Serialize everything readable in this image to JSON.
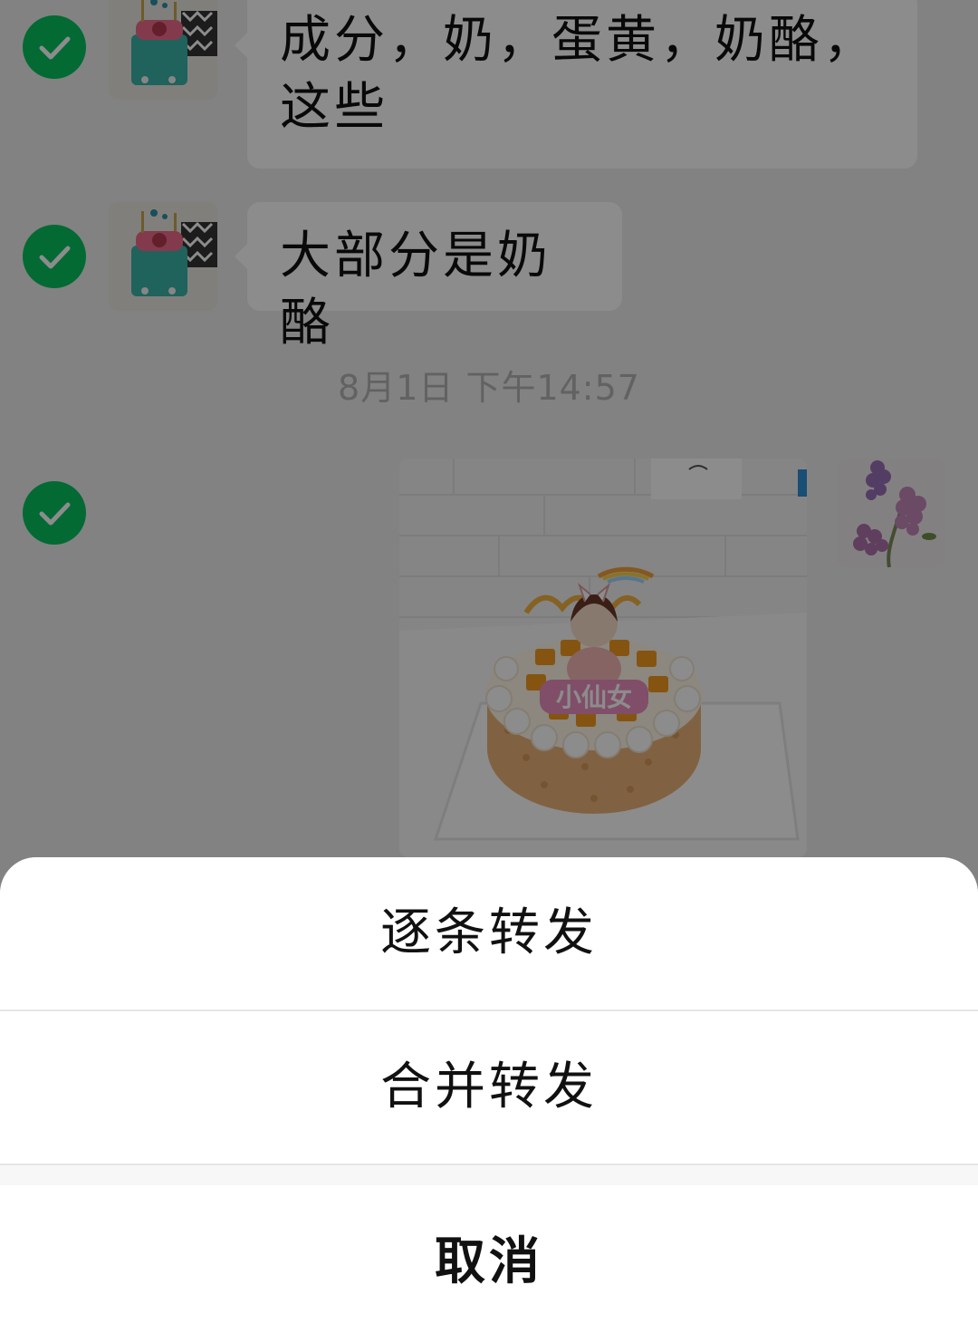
{
  "messages": [
    {
      "text": "成分，奶，蛋黄，奶酪，这些",
      "selected": true
    },
    {
      "text": "大部分是奶酪",
      "selected": true
    }
  ],
  "timestamp": "8月1日 下午14:57",
  "image_message": {
    "selected": true,
    "cake_topper_text": "小仙女"
  },
  "action_sheet": {
    "forward_one_by_one": "逐条转发",
    "merge_forward": "合并转发",
    "cancel": "取消"
  },
  "colors": {
    "check_green": "#07c160",
    "chat_background": "#ededed",
    "bubble_background": "#ffffff",
    "overlay": "rgba(0,0,0,0.45)"
  },
  "icons": [
    "checkmark-icon"
  ]
}
